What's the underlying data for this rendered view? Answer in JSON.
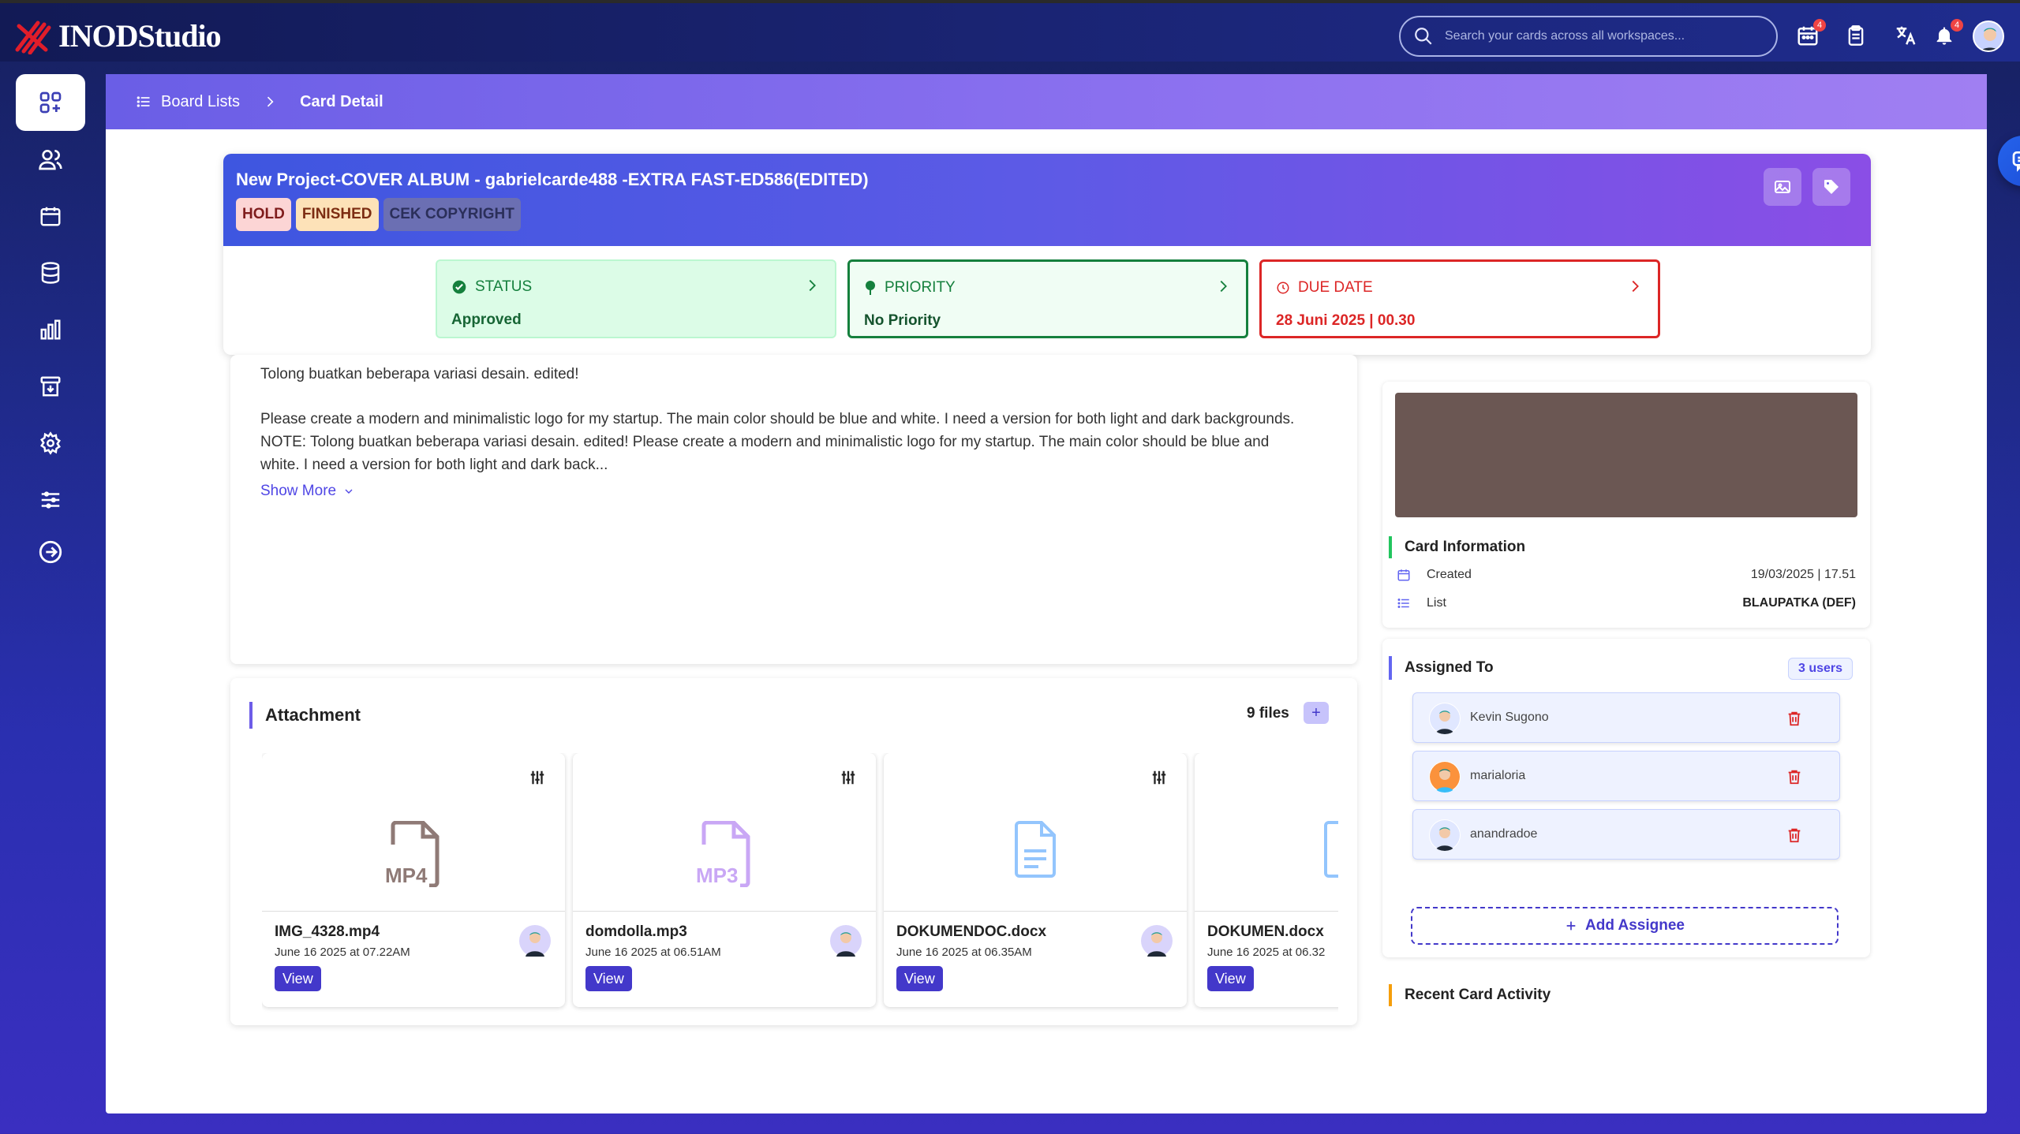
{
  "app": {
    "name": "INODStudio"
  },
  "search": {
    "placeholder": "Search your cards across all workspaces..."
  },
  "topbar": {
    "calendar_badge": "4",
    "notif_badge": "4"
  },
  "breadcrumb": {
    "parent": "Board Lists",
    "current": "Card Detail"
  },
  "card": {
    "title": "New Project-COVER ALBUM - gabrielcarde488 -EXTRA FAST-ED586(EDITED)",
    "tags": [
      "HOLD",
      "FINISHED",
      "CEK COPYRIGHT"
    ],
    "status": {
      "label": "STATUS",
      "value": "Approved"
    },
    "priority": {
      "label": "PRIORITY",
      "value": "No Priority"
    },
    "due": {
      "label": "DUE DATE",
      "value": "28 Juni 2025 | 00.30"
    }
  },
  "description": {
    "line1": "Tolong buatkan beberapa variasi desain. edited!",
    "para": "Please create a modern and minimalistic logo for my startup. The main color should be blue and white. I need a version for both light and dark backgrounds. NOTE: Tolong buatkan beberapa variasi desain. edited! Please create a modern and minimalistic logo for my startup. The main color should be blue and white. I need a version for both light and dark back...",
    "show_more": "Show More"
  },
  "attachments": {
    "title": "Attachment",
    "count": "9 files",
    "add": "+",
    "view_label": "View",
    "files": [
      {
        "name": "IMG_4328.mp4",
        "date": "June 16 2025 at 07.22AM",
        "type": "MP4"
      },
      {
        "name": "domdolla.mp3",
        "date": "June 16 2025 at 06.51AM",
        "type": "MP3"
      },
      {
        "name": "DOKUMENDOC.docx",
        "date": "June 16 2025 at 06.35AM",
        "type": "doc"
      },
      {
        "name": "DOKUMEN.docx",
        "date": "June 16 2025 at 06.32",
        "type": "doc"
      }
    ]
  },
  "card_info": {
    "title": "Card Information",
    "created_label": "Created",
    "created_value": "19/03/2025 | 17.51",
    "list_label": "List",
    "list_value": "BLAUPATKA (DEF)"
  },
  "assigned": {
    "title": "Assigned To",
    "count": "3 users",
    "users": [
      "Kevin Sugono",
      "marialoria",
      "anandradoe"
    ],
    "add_label": "Add Assignee"
  },
  "activity": {
    "title": "Recent Card Activity"
  },
  "colors": {
    "accent": "#4338ca",
    "status_green": "#15803d",
    "due_red": "#dc2626"
  }
}
